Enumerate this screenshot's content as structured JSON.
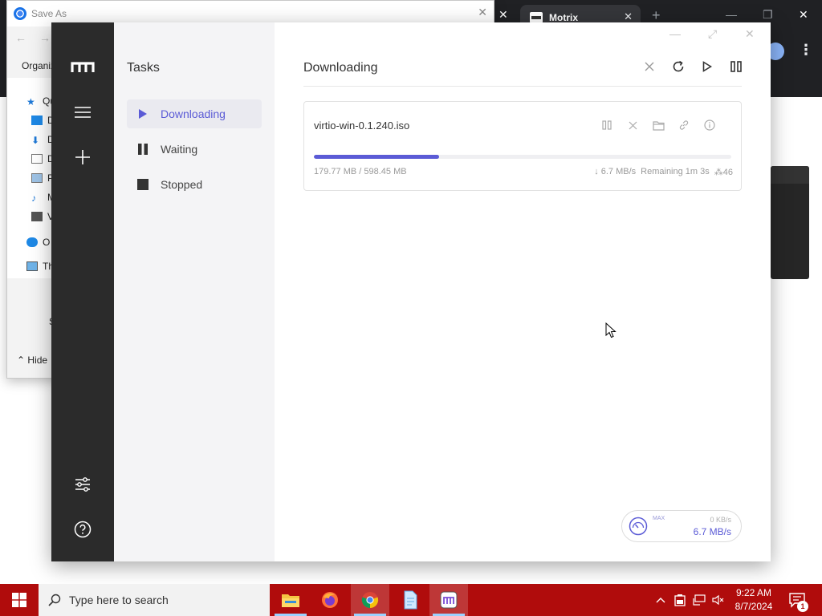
{
  "background": {
    "saveas_title": "Save As",
    "organize_label": "Organiz",
    "tree_items": [
      "Qu",
      "D",
      "D",
      "D",
      "P",
      "M",
      "V",
      "O",
      "Th"
    ],
    "hide_label": "Hide",
    "s_label": "S",
    "browser_tab_title": "Motrix"
  },
  "motrix": {
    "sidebar_title": "Tasks",
    "nav": [
      {
        "label": "Downloading",
        "icon": "play-icon"
      },
      {
        "label": "Waiting",
        "icon": "pause-icon"
      },
      {
        "label": "Stopped",
        "icon": "stop-icon"
      }
    ],
    "page_title": "Downloading",
    "task": {
      "name": "virtio-win-0.1.240.iso",
      "size_text": "179.77 MB / 598.45 MB",
      "progress_percent": 30.0,
      "speed_text": "↓ 6.7 MB/s",
      "remaining_text": "Remaining 1m 3s",
      "connections_text": "46"
    },
    "speedometer": {
      "max_label": "MAX",
      "upload": "0 KB/s",
      "download": "6.7 MB/s"
    },
    "accent": "#5b5bd6"
  },
  "taskbar": {
    "search_placeholder": "Type here to search",
    "time": "9:22 AM",
    "date": "8/7/2024",
    "notifications": "1",
    "color": "#b00c0c"
  }
}
